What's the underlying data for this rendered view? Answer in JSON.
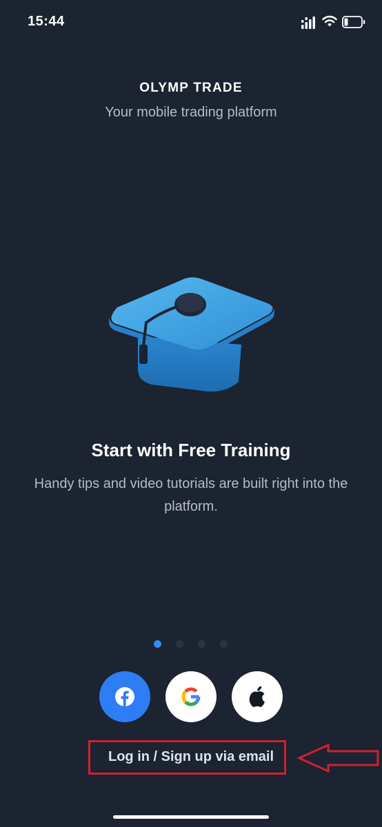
{
  "status_bar": {
    "time": "15:44",
    "icons": [
      "signal-icon",
      "wifi-icon",
      "battery-icon"
    ]
  },
  "header": {
    "logo": "OLYMP TRADE",
    "tagline": "Your mobile trading platform"
  },
  "slide": {
    "illustration": "graduation-cap-icon",
    "title": "Start with Free Training",
    "description": "Handy tips and video tutorials are built right into the platform."
  },
  "pager": {
    "count": 4,
    "active_index": 0
  },
  "social_login": [
    {
      "name": "facebook",
      "icon": "facebook-icon"
    },
    {
      "name": "google",
      "icon": "google-icon"
    },
    {
      "name": "apple",
      "icon": "apple-icon"
    }
  ],
  "email_login_label": "Log in / Sign up via email",
  "annotation": {
    "highlight_color": "#d2202f"
  },
  "colors": {
    "background": "#1c2331",
    "accent": "#2f8ff0",
    "facebook": "#2d7df4"
  }
}
